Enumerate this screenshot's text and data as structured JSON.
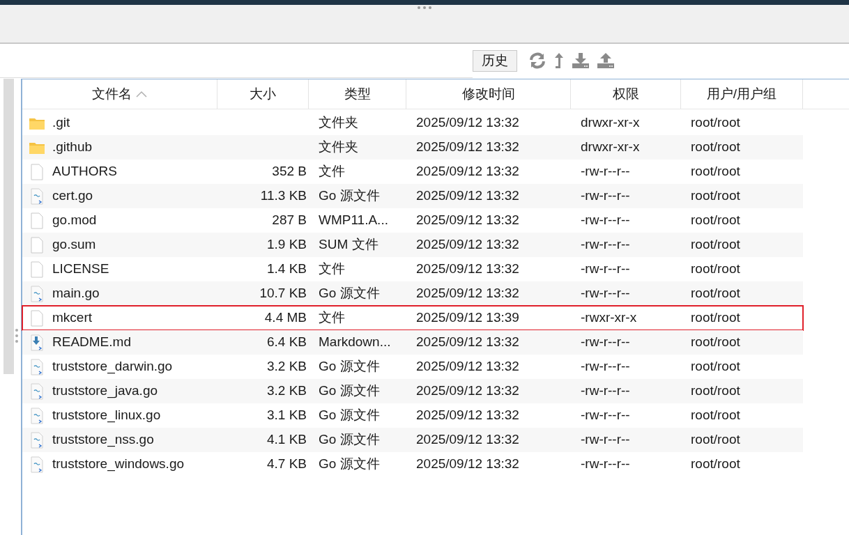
{
  "toolbar": {
    "history_button": "历史"
  },
  "table": {
    "columns": [
      {
        "label": "文件名",
        "sorted": true
      },
      {
        "label": "大小",
        "sorted": false
      },
      {
        "label": "类型",
        "sorted": false
      },
      {
        "label": "修改时间",
        "sorted": false
      },
      {
        "label": "权限",
        "sorted": false
      },
      {
        "label": "用户/用户组",
        "sorted": false
      }
    ],
    "rows": [
      {
        "kind": "folder",
        "name": ".git",
        "size": "",
        "type": "文件夹",
        "modified": "2025/09/12 13:32",
        "permissions": "drwxr-xr-x",
        "owner": "root/root",
        "highlighted": false
      },
      {
        "kind": "folder",
        "name": ".github",
        "size": "",
        "type": "文件夹",
        "modified": "2025/09/12 13:32",
        "permissions": "drwxr-xr-x",
        "owner": "root/root",
        "highlighted": false
      },
      {
        "kind": "file",
        "name": "AUTHORS",
        "size": "352 B",
        "type": "文件",
        "modified": "2025/09/12 13:32",
        "permissions": "-rw-r--r--",
        "owner": "root/root",
        "highlighted": false
      },
      {
        "kind": "go",
        "name": "cert.go",
        "size": "11.3 KB",
        "type": "Go 源文件",
        "modified": "2025/09/12 13:32",
        "permissions": "-rw-r--r--",
        "owner": "root/root",
        "highlighted": false
      },
      {
        "kind": "file",
        "name": "go.mod",
        "size": "287 B",
        "type": "WMP11.A...",
        "modified": "2025/09/12 13:32",
        "permissions": "-rw-r--r--",
        "owner": "root/root",
        "highlighted": false
      },
      {
        "kind": "file",
        "name": "go.sum",
        "size": "1.9 KB",
        "type": "SUM 文件",
        "modified": "2025/09/12 13:32",
        "permissions": "-rw-r--r--",
        "owner": "root/root",
        "highlighted": false
      },
      {
        "kind": "file",
        "name": "LICENSE",
        "size": "1.4 KB",
        "type": "文件",
        "modified": "2025/09/12 13:32",
        "permissions": "-rw-r--r--",
        "owner": "root/root",
        "highlighted": false
      },
      {
        "kind": "go",
        "name": "main.go",
        "size": "10.7 KB",
        "type": "Go 源文件",
        "modified": "2025/09/12 13:32",
        "permissions": "-rw-r--r--",
        "owner": "root/root",
        "highlighted": false
      },
      {
        "kind": "file",
        "name": "mkcert",
        "size": "4.4 MB",
        "type": "文件",
        "modified": "2025/09/12 13:39",
        "permissions": "-rwxr-xr-x",
        "owner": "root/root",
        "highlighted": true
      },
      {
        "kind": "markdown",
        "name": "README.md",
        "size": "6.4 KB",
        "type": "Markdown...",
        "modified": "2025/09/12 13:32",
        "permissions": "-rw-r--r--",
        "owner": "root/root",
        "highlighted": false
      },
      {
        "kind": "go",
        "name": "truststore_darwin.go",
        "size": "3.2 KB",
        "type": "Go 源文件",
        "modified": "2025/09/12 13:32",
        "permissions": "-rw-r--r--",
        "owner": "root/root",
        "highlighted": false
      },
      {
        "kind": "go",
        "name": "truststore_java.go",
        "size": "3.2 KB",
        "type": "Go 源文件",
        "modified": "2025/09/12 13:32",
        "permissions": "-rw-r--r--",
        "owner": "root/root",
        "highlighted": false
      },
      {
        "kind": "go",
        "name": "truststore_linux.go",
        "size": "3.1 KB",
        "type": "Go 源文件",
        "modified": "2025/09/12 13:32",
        "permissions": "-rw-r--r--",
        "owner": "root/root",
        "highlighted": false
      },
      {
        "kind": "go",
        "name": "truststore_nss.go",
        "size": "4.1 KB",
        "type": "Go 源文件",
        "modified": "2025/09/12 13:32",
        "permissions": "-rw-r--r--",
        "owner": "root/root",
        "highlighted": false
      },
      {
        "kind": "go",
        "name": "truststore_windows.go",
        "size": "4.7 KB",
        "type": "Go 源文件",
        "modified": "2025/09/12 13:32",
        "permissions": "-rw-r--r--",
        "owner": "root/root",
        "highlighted": false
      }
    ]
  }
}
